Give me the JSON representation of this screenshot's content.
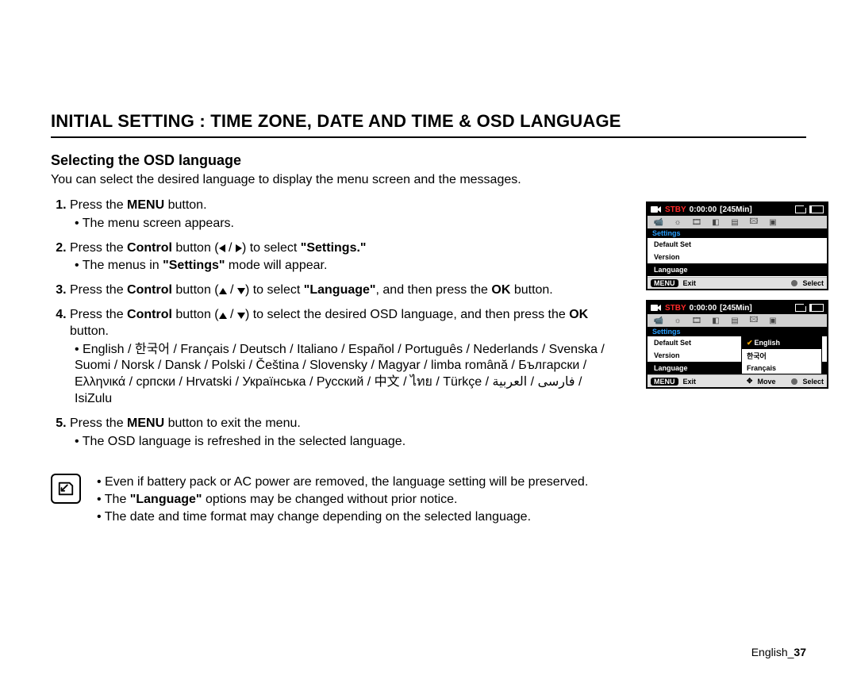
{
  "header": {
    "title": "INITIAL SETTING : TIME ZONE, DATE AND TIME & OSD LANGUAGE",
    "subtitle": "Selecting the OSD language",
    "intro": "You can select the desired language to display the menu screen and the messages."
  },
  "steps": {
    "s1_a": "Press the ",
    "s1_b": "MENU",
    "s1_c": " button.",
    "s1_sub1": "The menu screen appears.",
    "s2_a": " Press the ",
    "s2_b": "Control",
    "s2_c": " button (",
    "s2_d": ") to select ",
    "s2_e": "\"Settings.\"",
    "s2_sub1_a": "The menus in ",
    "s2_sub1_b": "\"Settings\"",
    "s2_sub1_c": " mode will appear.",
    "s3_a": "Press the ",
    "s3_b": "Control",
    "s3_c": " button (",
    "s3_d": ") to select ",
    "s3_e": "\"Language\"",
    "s3_f": ", and then press the ",
    "s3_g": "OK",
    "s3_h": " button.",
    "s4_a": "Press the ",
    "s4_b": "Control",
    "s4_c": " button (",
    "s4_d": ") to select the desired OSD language, and then press the ",
    "s4_e": "OK",
    "s4_f": " button.",
    "s4_langs": "English / 한국어 / Français / Deutsch / Italiano / Español / Português / Nederlands / Svenska / Suomi / Norsk / Dansk / Polski / Čeština / Slovensky / Magyar / limba română / Български / Ελληνικά / српски / Hrvatski / Українська / Русский / 中文 / ไทย / Türkçe / فارسی / العربية / IsiZulu",
    "s5_a": "Press the ",
    "s5_b": "MENU",
    "s5_c": " button to exit the menu.",
    "s5_sub1": "The OSD language is refreshed in the selected language."
  },
  "notes": {
    "n1": "Even if battery pack or AC power are removed, the language setting will be preserved.",
    "n2_a": "The ",
    "n2_b": "\"Language\"",
    "n2_c": " options may be changed without prior notice.",
    "n3": "The date and time format may change depending on the selected language."
  },
  "footer": {
    "label": "English_",
    "page": "37"
  },
  "osd": {
    "stby": "STBY",
    "time": "0:00:00",
    "remaining": "[245Min]",
    "section": "Settings",
    "items": {
      "default_set": "Default Set",
      "version": "Version",
      "language": "Language"
    },
    "footer": {
      "menu": "MENU",
      "exit": "Exit",
      "select": "Select",
      "move": "Move"
    },
    "popup": {
      "english": "English",
      "korean": "한국어",
      "french": "Français"
    }
  }
}
